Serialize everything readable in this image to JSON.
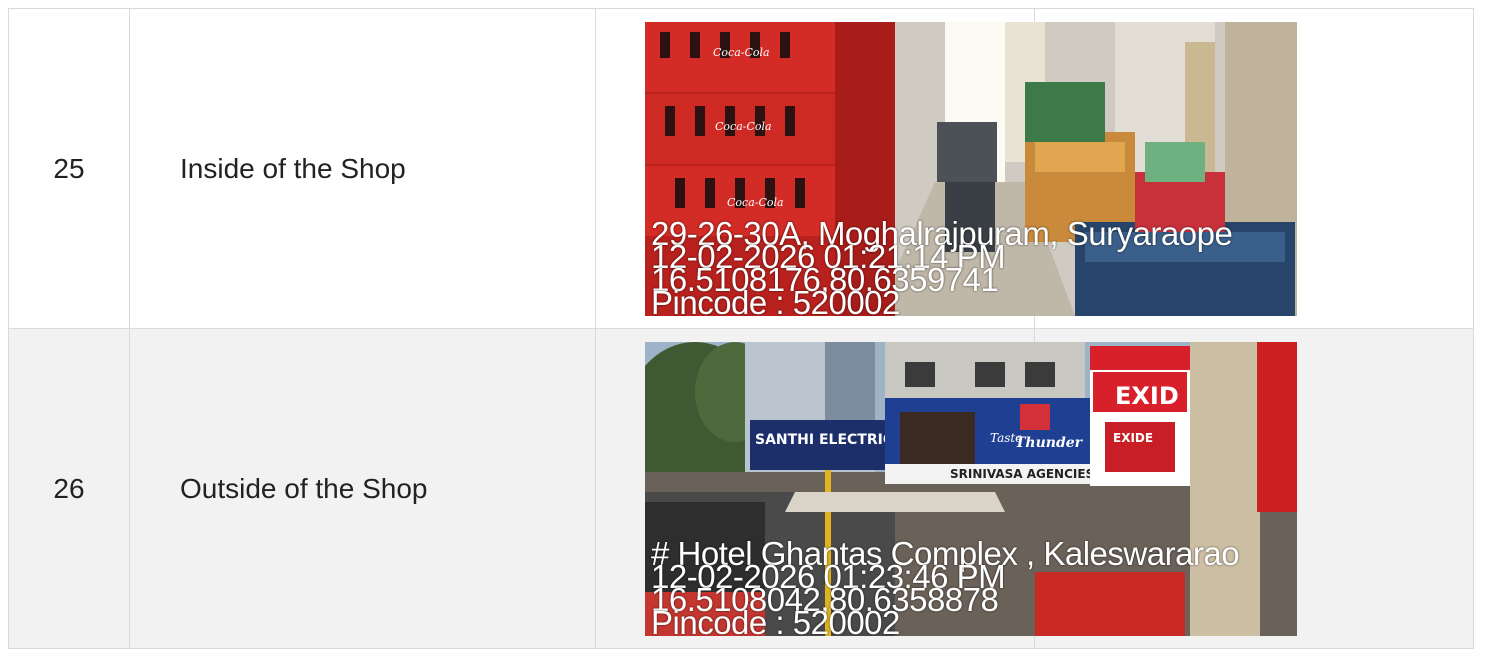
{
  "rows": [
    {
      "number": "25",
      "label": "Inside of the Shop",
      "photo": {
        "scene": "shop-interior-with-coca-cola-crates",
        "stamp": {
          "address": "29-26-30A, Moghalrajpuram, Suryaraope",
          "datetime": "12-02-2026 01:21:14 PM",
          "coords": "16.5108176,80.6359741",
          "pincode": "Pincode : 520002"
        },
        "crate_brand": "Coca-Cola"
      }
    },
    {
      "number": "26",
      "label": "Outside of the Shop",
      "photo": {
        "scene": "shop-exterior-street-with-signboards",
        "stamp": {
          "address": "# Hotel Ghantas Complex , Kaleswararao",
          "datetime": "12-02-2026 01:23:46 PM",
          "coords": "16.5108042,80.6358878",
          "pincode": "Pincode : 520002"
        },
        "signs": {
          "electricals": "SANTHI ELECTRICA",
          "agencies": "SRINIVASA AGENCIES",
          "tagline_1": "Taste",
          "tagline_2": "Thunder",
          "battery": "EXID",
          "battery_box": "EXIDE"
        }
      }
    }
  ],
  "colors": {
    "border": "#d9d9d9",
    "alt_row": "#f2f2f2",
    "crate_red": "#d32b25",
    "banner_blue": "#1f3f93"
  }
}
